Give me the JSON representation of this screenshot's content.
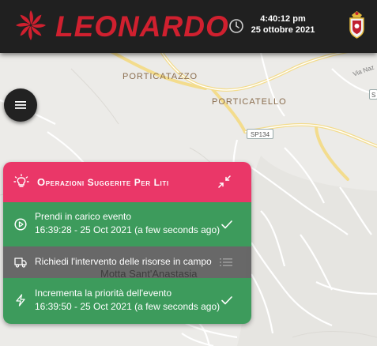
{
  "header": {
    "brand": "LEONARDO",
    "time": "4:40:12 pm",
    "date": "25 ottobre 2021",
    "icons": {
      "logo": "leonardo-propeller-logo",
      "clock": "clock-icon",
      "emblem": "police-crest-emblem"
    },
    "colors": {
      "background": "#202020",
      "brand": "#d0202f"
    }
  },
  "map": {
    "labels": {
      "porticatazzo": "PORTICATAZZO",
      "porticatello": "PORTICATELLO",
      "motta": "Motta Sant'Anastasia",
      "via": "Via Naz",
      "sp134": "SP134",
      "edge_badge": "S"
    }
  },
  "menu": {
    "icon": "hamburger-menu-icon"
  },
  "panel": {
    "title": "Operazioni Suggerite Per Liti",
    "header_color": "#ea3768",
    "operations": [
      {
        "label": "Prendi in carico evento",
        "detail": "16:39:28 - 25 Oct 2021 (a few seconds ago)",
        "icon": "play-circle-icon",
        "state_icon": "check-icon",
        "color": "#3d9b5c"
      },
      {
        "label": "Richiedi l'intervento delle risorse in campo",
        "detail": "",
        "icon": "truck-icon",
        "state_icon": "list-icon",
        "color": "#555555"
      },
      {
        "label": "Incrementa la priorità dell'evento",
        "detail": "16:39:50 - 25 Oct 2021 (a few seconds ago)",
        "icon": "lightning-bolt-icon",
        "state_icon": "check-icon",
        "color": "#3d9b5c"
      }
    ]
  }
}
